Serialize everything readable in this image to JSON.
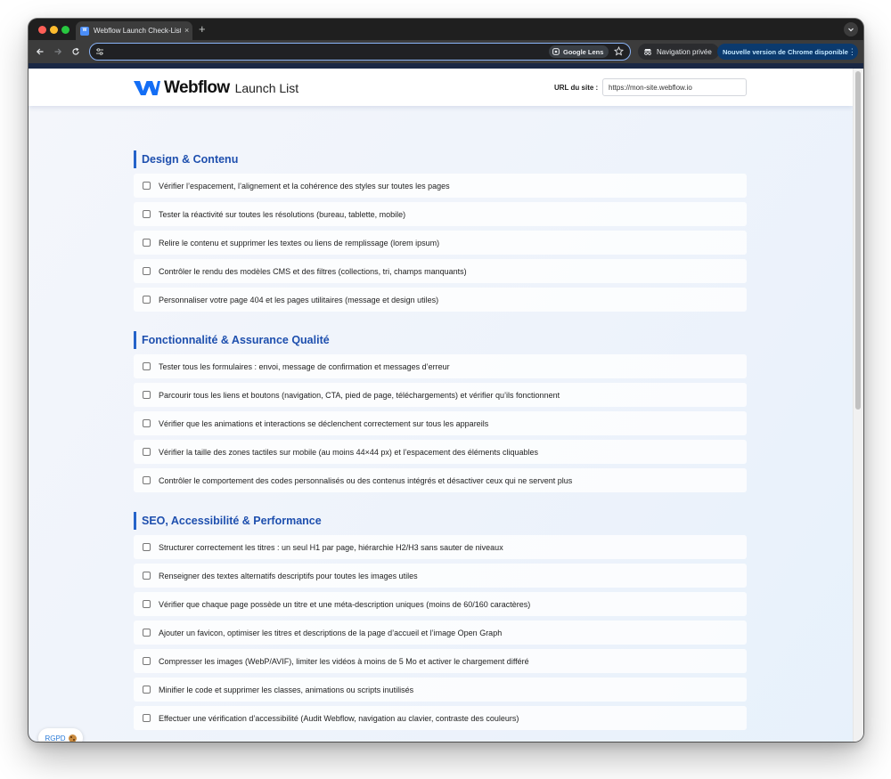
{
  "browser": {
    "tab_title": "Webflow Launch Check-List",
    "tab_close": "×",
    "new_tab": "+",
    "lens_label": "Google Lens",
    "incognito_label": "Navigation privée",
    "update_label": "Nouvelle version de Chrome disponible",
    "accent_color": "#8ab4f8"
  },
  "header": {
    "logo_word": "Webflow",
    "logo_sub": "Launch List",
    "url_label": "URL du site :",
    "url_value": "https://mon-site.webflow.io"
  },
  "sections": [
    {
      "title": "Design & Contenu",
      "items": [
        "Vérifier l’espacement, l’alignement et la cohérence des styles sur toutes les pages",
        "Tester la réactivité sur toutes les résolutions (bureau, tablette, mobile)",
        "Relire le contenu et supprimer les textes ou liens de remplissage (lorem ipsum)",
        "Contrôler le rendu des modèles CMS et des filtres (collections, tri, champs manquants)",
        "Personnaliser votre page 404 et les pages utilitaires (message et design utiles)"
      ]
    },
    {
      "title": "Fonctionnalité & Assurance Qualité",
      "items": [
        "Tester tous les formulaires : envoi, message de confirmation et messages d’erreur",
        "Parcourir tous les liens et boutons (navigation, CTA, pied de page, téléchargements) et vérifier qu’ils fonctionnent",
        "Vérifier que les animations et interactions se déclenchent correctement sur tous les appareils",
        "Vérifier la taille des zones tactiles sur mobile (au moins 44×44 px) et l’espacement des éléments cliquables",
        "Contrôler le comportement des codes personnalisés ou des contenus intégrés et désactiver ceux qui ne servent plus"
      ]
    },
    {
      "title": "SEO, Accessibilité & Performance",
      "items": [
        "Structurer correctement les titres : un seul H1 par page, hiérarchie H2/H3 sans sauter de niveaux",
        "Renseigner des textes alternatifs descriptifs pour toutes les images utiles",
        "Vérifier que chaque page possède un titre et une méta-description uniques (moins de 60/160 caractères)",
        "Ajouter un favicon, optimiser les titres et descriptions de la page d’accueil et l’image Open Graph",
        "Compresser les images (WebP/AVIF), limiter les vidéos à moins de 5 Mo et activer le chargement différé",
        "Minifier le code et supprimer les classes, animations ou scripts inutilisés",
        "Effectuer une vérification d’accessibilité (Audit Webflow, navigation au clavier, contraste des couleurs)"
      ]
    }
  ],
  "rgpd_label": "RGPD",
  "colors": {
    "section_title": "#1e4fae",
    "section_bar": "#2563c9",
    "logo_blue": "#146ef5",
    "update_pill": "#0b3a6e"
  }
}
